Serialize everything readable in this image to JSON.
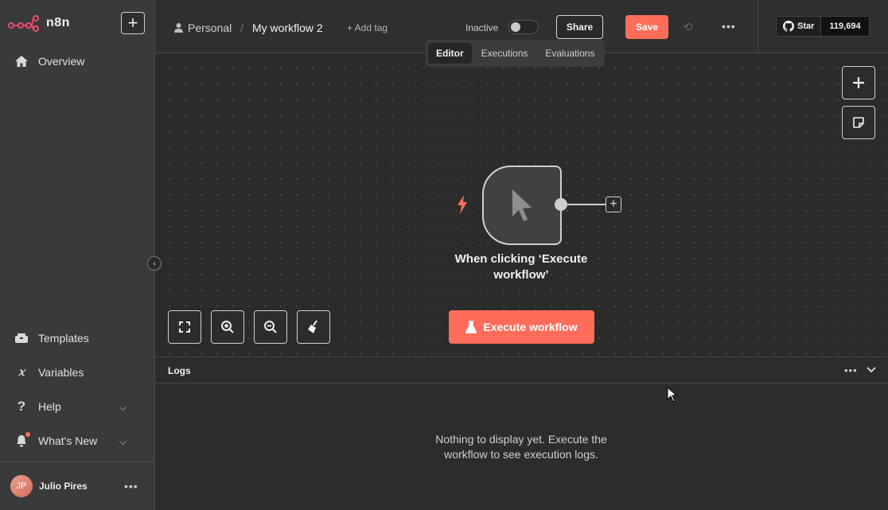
{
  "app": {
    "name": "n8n",
    "brand_color": "#ff6d5a"
  },
  "sidebar": {
    "new_icon": "plus-icon",
    "items_top": [
      {
        "label": "Overview",
        "icon": "home-icon"
      }
    ],
    "items_bottom": [
      {
        "label": "Templates",
        "icon": "templates-icon"
      },
      {
        "label": "Variables",
        "icon": "variables-icon"
      },
      {
        "label": "Help",
        "icon": "question-icon",
        "expandable": true
      },
      {
        "label": "What's New",
        "icon": "bell-icon",
        "expandable": true,
        "notification": true
      }
    ],
    "collapse_icon": "chevron-left-icon",
    "user": {
      "initials": "JP",
      "name": "Julio Pires"
    }
  },
  "header": {
    "project": "Personal",
    "separator": "/",
    "workflow_name": "My workflow 2",
    "add_tag": "+ Add tag",
    "status_label": "Inactive",
    "active": false,
    "share_label": "Share",
    "save_label": "Save",
    "github": {
      "star_label": "Star",
      "count": "119,694"
    }
  },
  "tabs": [
    {
      "label": "Editor",
      "active": true
    },
    {
      "label": "Executions",
      "active": false
    },
    {
      "label": "Evaluations",
      "active": false
    }
  ],
  "canvas": {
    "node": {
      "label": "When clicking ‘Execute workflow’",
      "icon": "cursor-icon",
      "trigger_icon": "lightning-icon"
    },
    "execute_label": "Execute workflow"
  },
  "logs": {
    "title": "Logs",
    "empty_message": "Nothing to display yet. Execute the workflow to see execution logs."
  }
}
